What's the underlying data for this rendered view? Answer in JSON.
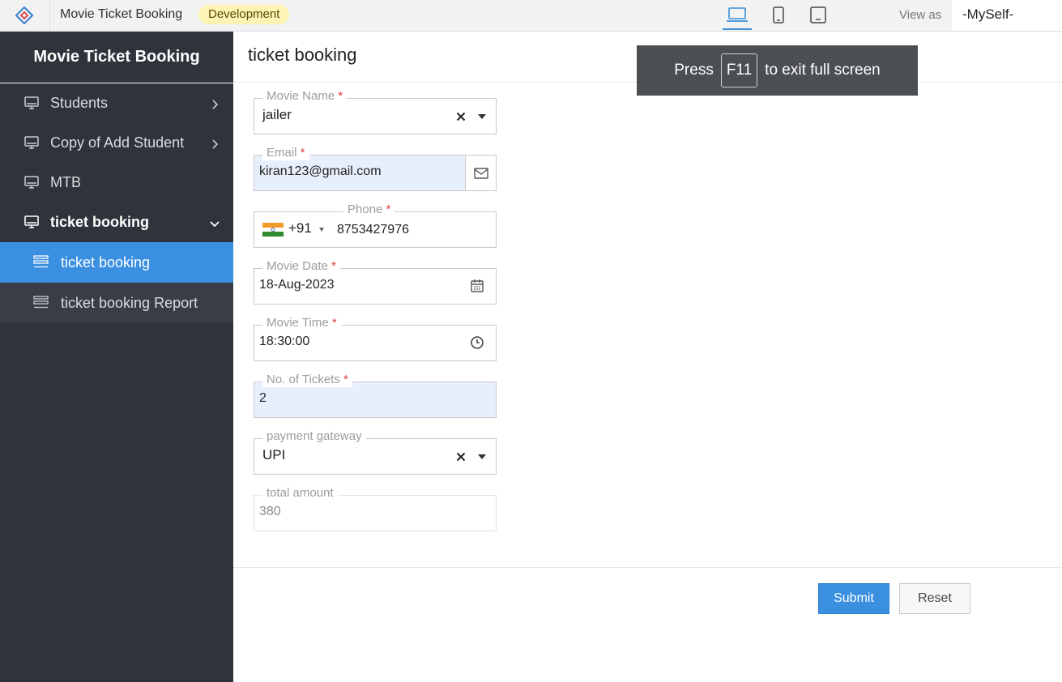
{
  "topbar": {
    "app_name": "Movie Ticket Booking",
    "environment": "Development",
    "view_as_label": "View as",
    "user": "-MySelf-",
    "devices": [
      "laptop-icon",
      "phone-icon",
      "tablet-icon"
    ],
    "active_device": "laptop-icon"
  },
  "sidebar": {
    "title": "Movie Ticket Booking",
    "items": [
      {
        "label": "Students",
        "icon": "monitor-icon",
        "chevron": "right"
      },
      {
        "label": "Copy of Add Student",
        "icon": "monitor-icon",
        "chevron": "right"
      },
      {
        "label": "MTB",
        "icon": "monitor-icon"
      },
      {
        "label": "ticket booking",
        "icon": "monitor-icon",
        "chevron": "down",
        "expanded": true
      }
    ],
    "subitems": [
      {
        "label": "ticket booking",
        "icon": "list-icon",
        "active": true
      },
      {
        "label": "ticket booking Report",
        "icon": "list-icon"
      }
    ]
  },
  "page": {
    "title": "ticket booking"
  },
  "toast": {
    "prefix": "Press",
    "key": "F11",
    "suffix": "to exit full screen"
  },
  "form": {
    "movie_name": {
      "label": "Movie Name",
      "required": "*",
      "value": "jailer"
    },
    "email": {
      "label": "Email",
      "required": "*",
      "value": "kiran123@gmail.com"
    },
    "phone": {
      "label": "Phone",
      "required": "*",
      "dial_code": "+91",
      "value": "8753427976",
      "country": "India"
    },
    "movie_date": {
      "label": "Movie Date",
      "required": "*",
      "value": "18-Aug-2023"
    },
    "movie_time": {
      "label": "Movie Time",
      "required": "*",
      "value": "18:30:00"
    },
    "tickets": {
      "label": "No. of Tickets",
      "required": "*",
      "value": "2"
    },
    "payment_gateway": {
      "label": "payment gateway",
      "value": "UPI"
    },
    "total_amount": {
      "label": "total amount",
      "value": "380"
    }
  },
  "actions": {
    "submit": "Submit",
    "reset": "Reset"
  },
  "colors": {
    "sidebar_bg": "#2f333b",
    "active_item": "#3a8fe0",
    "accent": "#3a8fd9",
    "badge_bg": "#fdf3b5",
    "required": "#e23c3c",
    "tinted_input": "#e8effc"
  }
}
